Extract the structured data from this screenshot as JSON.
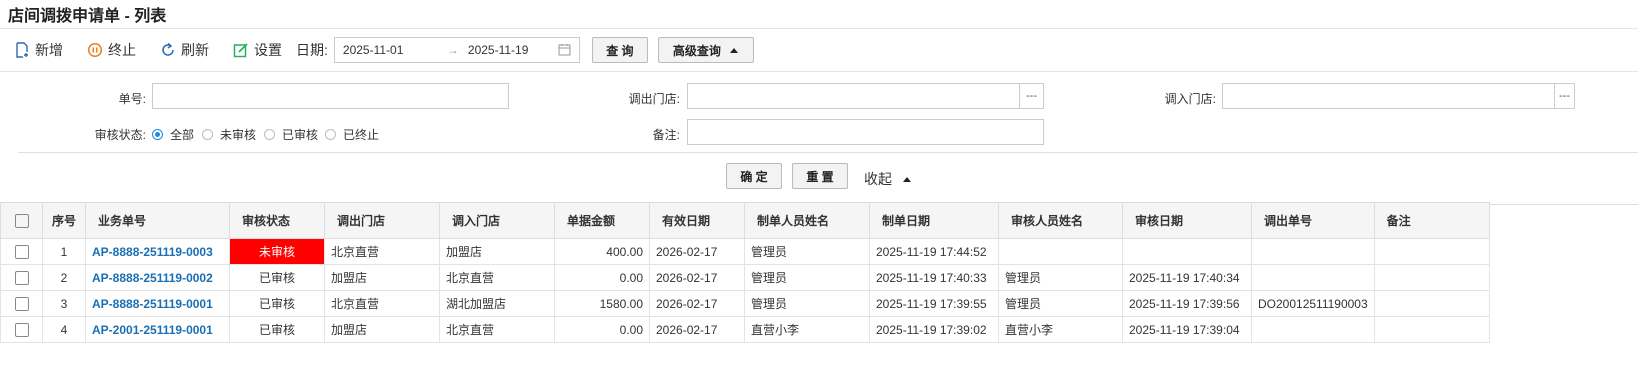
{
  "window": {
    "title": "店间调拨申请单 - 列表"
  },
  "toolbar": {
    "add": "新增",
    "terminate": "终止",
    "refresh": "刷新",
    "settings": "设置",
    "date_label": "日期:",
    "date_from": "2025-11-01",
    "date_arrow": "→",
    "date_to": "2025-11-19",
    "query": "查 询",
    "advanced": "高级查询"
  },
  "filters": {
    "order_no_label": "单号:",
    "out_store_label": "调出门店:",
    "in_store_label": "调入门店:",
    "status_label": "审核状态:",
    "status_options": [
      "全部",
      "未审核",
      "已审核",
      "已终止"
    ],
    "status_selected": "全部",
    "remark_label": "备注:",
    "dots": "---",
    "confirm": "确 定",
    "reset": "重 置",
    "collapse": "收起"
  },
  "table": {
    "headers": [
      "序号",
      "业务单号",
      "审核状态",
      "调出门店",
      "调入门店",
      "单据金额",
      "有效日期",
      "制单人员姓名",
      "制单日期",
      "审核人员姓名",
      "审核日期",
      "调出单号",
      "备注"
    ],
    "rows": [
      {
        "seq": "1",
        "no": "AP-8888-251119-0003",
        "status": "未审核",
        "out": "北京直营",
        "in": "加盟店",
        "amount": "400.00",
        "valid": "2026-02-17",
        "maker": "管理员",
        "make_date": "2025-11-19 17:44:52",
        "auditor": "",
        "audit_date": "",
        "out_no": "",
        "remark": ""
      },
      {
        "seq": "2",
        "no": "AP-8888-251119-0002",
        "status": "已审核",
        "out": "加盟店",
        "in": "北京直营",
        "amount": "0.00",
        "valid": "2026-02-17",
        "maker": "管理员",
        "make_date": "2025-11-19 17:40:33",
        "auditor": "管理员",
        "audit_date": "2025-11-19 17:40:34",
        "out_no": "",
        "remark": ""
      },
      {
        "seq": "3",
        "no": "AP-8888-251119-0001",
        "status": "已审核",
        "out": "北京直营",
        "in": "湖北加盟店",
        "amount": "1580.00",
        "valid": "2026-02-17",
        "maker": "管理员",
        "make_date": "2025-11-19 17:39:55",
        "auditor": "管理员",
        "audit_date": "2025-11-19 17:39:56",
        "out_no": "DO20012511190003",
        "remark": ""
      },
      {
        "seq": "4",
        "no": "AP-2001-251119-0001",
        "status": "已审核",
        "out": "加盟店",
        "in": "北京直营",
        "amount": "0.00",
        "valid": "2026-02-17",
        "maker": "直营小李",
        "make_date": "2025-11-19 17:39:02",
        "auditor": "直营小李",
        "audit_date": "2025-11-19 17:39:04",
        "out_no": "",
        "remark": ""
      }
    ]
  },
  "colors": {
    "link": "#1a6fb4",
    "unaudited_bg": "#ff0000",
    "radio_accent": "#1e88e5"
  }
}
